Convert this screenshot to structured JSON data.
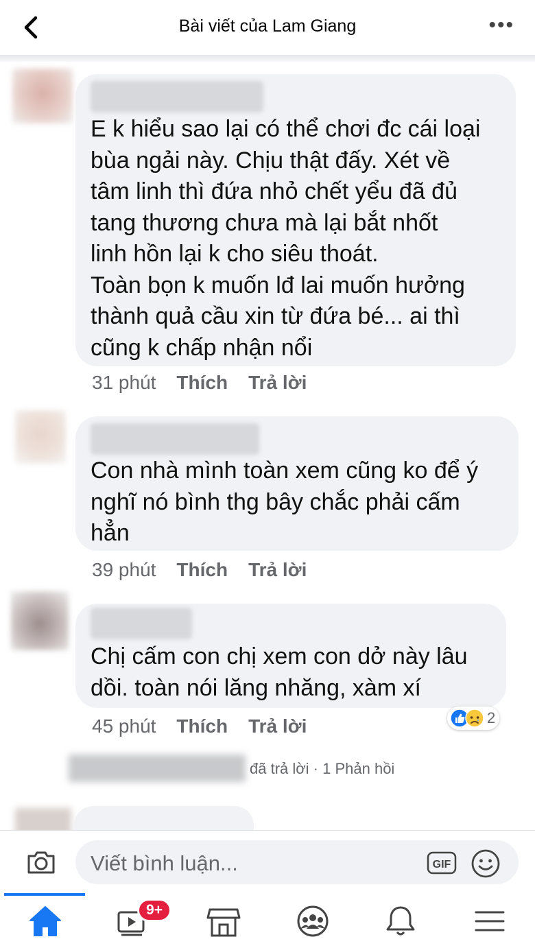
{
  "header": {
    "title": "Bài viết của Lam Giang"
  },
  "comments": [
    {
      "lines": [
        "E k hiểu sao lại có thể chơi đc cái loại",
        "bùa ngải này. Chịu thật đấy. Xét về",
        "tâm linh thì đứa nhỏ chết yểu đã đủ",
        "tang thương chưa mà lại bắt nhốt",
        "linh hồn lại k cho siêu thoát.",
        "Toàn bọn k muốn lđ lai muốn hưởng",
        "thành quả cầu xin từ đứa bé... ai thì",
        "cũng k chấp nhận nổi"
      ],
      "time": "31 phút",
      "like": "Thích",
      "reply": "Trả lời"
    },
    {
      "lines": [
        "Con nhà mình toàn xem cũng ko để ý",
        "nghĩ nó bình thg bây chắc phải cấm",
        "hẳn"
      ],
      "time": "39 phút",
      "like": "Thích",
      "reply": "Trả lời"
    },
    {
      "lines": [
        "Chị cấm con chị xem con dở này lâu",
        "dồi. toàn nói lăng nhăng, xàm xí"
      ],
      "time": "45 phút",
      "like": "Thích",
      "reply": "Trả lời",
      "reactions": {
        "icons": [
          "like-icon",
          "sad-icon"
        ],
        "count": "2"
      }
    }
  ],
  "replies": {
    "text": "đã trả lời · 1 Phản hồi"
  },
  "composer": {
    "placeholder": "Viết bình luận..."
  },
  "tabbar": {
    "badge": "9+",
    "accent": "#1877f2",
    "badge_color": "#e41e3f"
  }
}
